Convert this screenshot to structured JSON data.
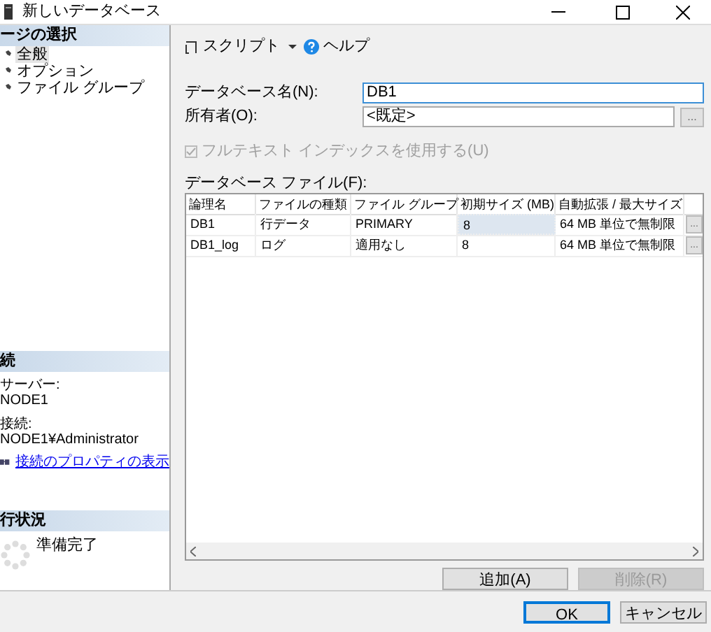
{
  "window": {
    "title": "新しいデータベース"
  },
  "page_select": {
    "header": "ージの選択",
    "items": [
      {
        "label": "全般",
        "selected": true
      },
      {
        "label": "オプション",
        "selected": false
      },
      {
        "label": "ファイル グループ",
        "selected": false
      }
    ]
  },
  "connection": {
    "header": "続",
    "server_label": "サーバー:",
    "server": "NODE1",
    "conn_label": "接続:",
    "conn": "NODE1¥Administrator",
    "link": "接続のプロパティの表示"
  },
  "progress": {
    "header": "行状況",
    "status": "準備完了"
  },
  "toolbar": {
    "script": "スクリプト",
    "help": "ヘルプ"
  },
  "form": {
    "name_label": "データベース名(N):",
    "name_value": "DB1",
    "owner_label": "所有者(O):",
    "owner_value": "<既定>",
    "owner_button": "...",
    "fulltext": {
      "label": "フルテキスト インデックスを使用する(U)",
      "checked": true,
      "disabled": true
    }
  },
  "files": {
    "label": "データベース ファイル(F):",
    "columns": [
      "論理名",
      "ファイルの種類",
      "ファイル グループ",
      "初期サイズ (MB)",
      "自動拡張 / 最大サイズ"
    ],
    "rows": [
      {
        "cells": [
          "DB1",
          "行データ",
          "PRIMARY",
          "8",
          "64 MB 単位で無制限"
        ],
        "button": "...",
        "focused": true
      },
      {
        "cells": [
          "DB1_log",
          "ログ",
          "適用なし",
          "8",
          "64 MB 単位で無制限"
        ],
        "button": "...",
        "focused": false
      }
    ]
  },
  "buttons": [
    {
      "label": "追加(A)",
      "disabled": false
    },
    {
      "label": "削除(R)",
      "disabled": true
    }
  ],
  "footer": [
    {
      "label": "OK",
      "default": true
    },
    {
      "label": "キャンセル",
      "default": false
    }
  ]
}
